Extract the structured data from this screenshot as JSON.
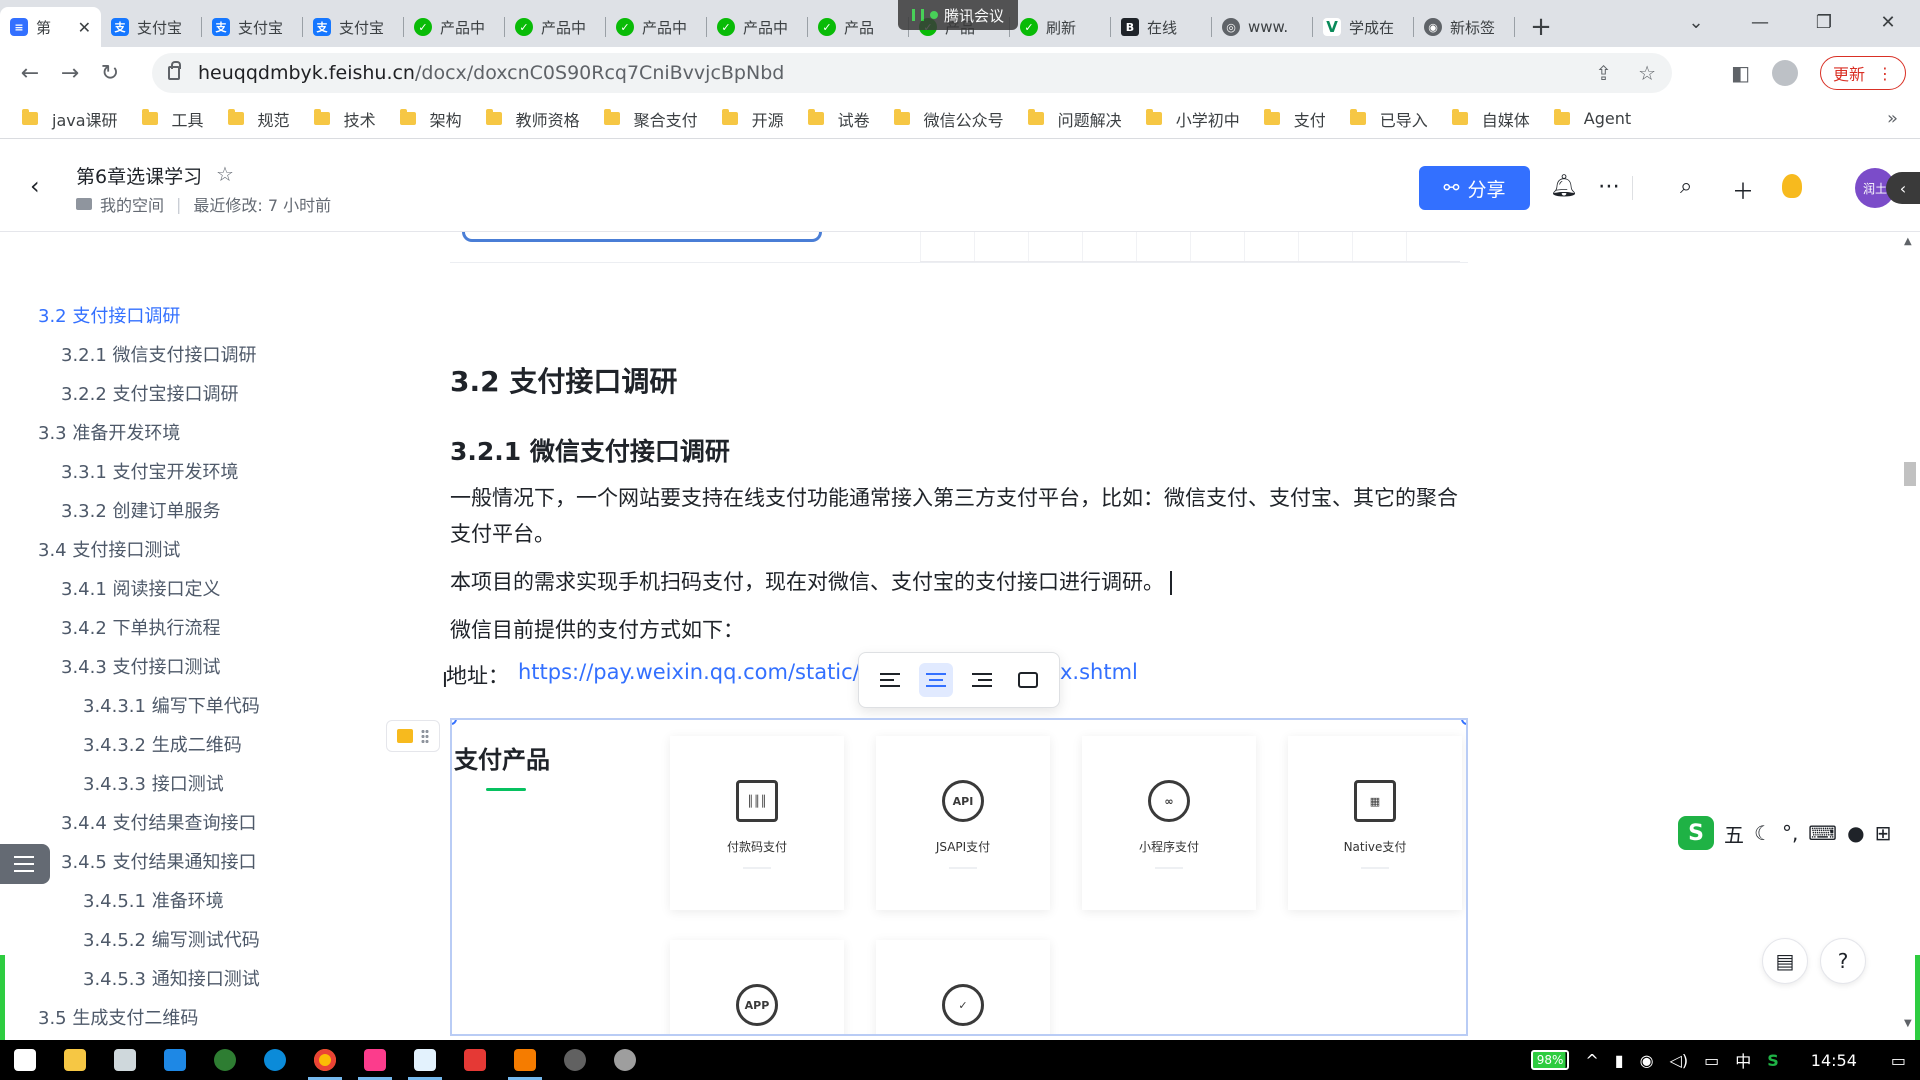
{
  "browser": {
    "tabs": [
      {
        "label": "第",
        "icon": "feishu-doc-icon",
        "active": true
      },
      {
        "label": "支付宝",
        "icon": "alipay-icon"
      },
      {
        "label": "支付宝",
        "icon": "alipay-icon"
      },
      {
        "label": "支付宝",
        "icon": "alipay-icon"
      },
      {
        "label": "产品中",
        "icon": "wechat-icon"
      },
      {
        "label": "产品中",
        "icon": "wechat-icon"
      },
      {
        "label": "产品中",
        "icon": "wechat-icon"
      },
      {
        "label": "产品中",
        "icon": "wechat-icon"
      },
      {
        "label": "产品",
        "icon": "wechat-icon"
      },
      {
        "label": "产品",
        "icon": "wechat-icon"
      },
      {
        "label": "刷新",
        "icon": "wechat-icon"
      },
      {
        "label": "在线",
        "icon": "bold-b-icon"
      },
      {
        "label": "www.",
        "icon": "globe-icon"
      },
      {
        "label": "学成在",
        "icon": "vue-icon"
      },
      {
        "label": "新标签",
        "icon": "chrome-icon"
      }
    ],
    "meeting_badge": "腾讯会议",
    "url_host": "heuqqdmbyk.feishu.cn",
    "url_path": "/docx/doxcnC0S90Rcq7CniBvvjcBpNbd",
    "update_label": "更新",
    "bookmarks": [
      "java课研",
      "工具",
      "规范",
      "技术",
      "架构",
      "教师资格",
      "聚合支付",
      "开源",
      "试卷",
      "微信公众号",
      "问题解决",
      "小学初中",
      "支付",
      "已导入",
      "自媒体",
      "Agent"
    ]
  },
  "doc_header": {
    "title": "第6章选课学习",
    "space": "我的空间",
    "last_modified": "最近修改: 7 小时前",
    "share_label": "分享",
    "avatar_text": "润土"
  },
  "toc": [
    {
      "label": "3.2 支付接口调研",
      "active": true
    },
    {
      "label": "3.2.1 微信支付接口调研"
    },
    {
      "label": "3.2.2 支付宝接口调研"
    },
    {
      "label": "3.3 准备开发环境"
    },
    {
      "label": "3.3.1 支付宝开发环境"
    },
    {
      "label": "3.3.2 创建订单服务"
    },
    {
      "label": "3.4 支付接口测试"
    },
    {
      "label": "3.4.1 阅读接口定义"
    },
    {
      "label": "3.4.2 下单执行流程"
    },
    {
      "label": "3.4.3 支付接口测试"
    },
    {
      "label": "3.4.3.1 编写下单代码"
    },
    {
      "label": "3.4.3.2 生成二维码"
    },
    {
      "label": "3.4.3.3 接口测试"
    },
    {
      "label": "3.4.4 支付结果查询接口"
    },
    {
      "label": "3.4.5 支付结果通知接口"
    },
    {
      "label": "3.4.5.1 准备环境"
    },
    {
      "label": "3.4.5.2 编写测试代码"
    },
    {
      "label": "3.4.5.3 通知接口测试"
    },
    {
      "label": "3.5 生成支付二维码"
    }
  ],
  "content": {
    "h2": "3.2 支付接口调研",
    "h3": "3.2.1 微信支付接口调研",
    "p1": "一般情况下，一个网站要支持在线支付功能通常接入第三方支付平台，比如：微信支付、支付宝、其它的聚合支付平台。",
    "p2": "本项目的需求实现手机扫码支付，现在对微信、支付宝的支付接口进行调研。",
    "p3": "微信目前提供的支付方式如下：",
    "addr_label": "地址：",
    "addr_link": "https://pay.weixin.qq.com/static/p",
    "addr_link_tail": "x.shtml"
  },
  "image_block": {
    "title": "支付产品",
    "products": [
      {
        "label": "付款码支付",
        "icon": "barcode-icon"
      },
      {
        "label": "JSAPI支付",
        "icon": "api-icon"
      },
      {
        "label": "小程序支付",
        "icon": "mini-program-icon"
      },
      {
        "label": "Native支付",
        "icon": "qrcode-icon"
      },
      {
        "label": "",
        "icon": "app-icon"
      },
      {
        "label": "",
        "icon": "face-pay-icon"
      }
    ],
    "api_text": "API",
    "app_text": "APP"
  },
  "ime": {
    "mode": "五"
  },
  "taskbar": {
    "battery": "98%",
    "ime_lang": "中",
    "clock": "14:54"
  }
}
